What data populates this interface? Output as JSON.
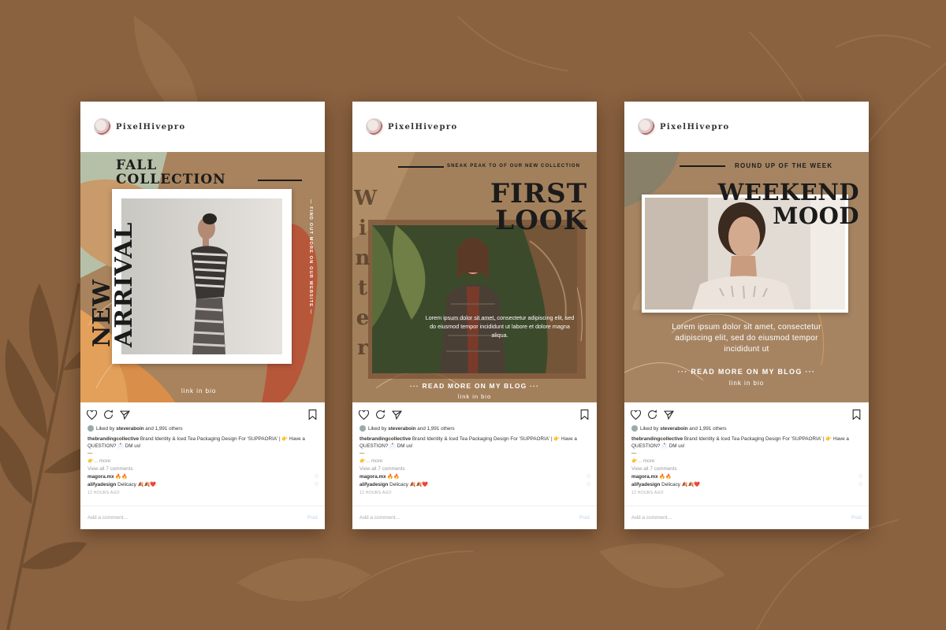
{
  "colors": {
    "background": "#8a6240",
    "post_brown": "#a68360",
    "accent_orange": "#e39a4c",
    "rust": "#b7573a",
    "sage": "#b7c3ad"
  },
  "posts": [
    {
      "username": "PixelHivepro",
      "avatar_icon": "profile-avatar",
      "title_line1": "FALL",
      "title_line2": "COLLECTION",
      "vertical_line1": "NEW",
      "vertical_line2": "ARRIVAL",
      "side_text": "— FIND OUT MORE ON OUR WEBSITE —",
      "link_text": "link in bio",
      "liked_by": "Liked by ",
      "liked_user": "steveraboin",
      "liked_rest": " and 1,991 others",
      "caption_user": "thebrandingcollective",
      "caption": " Brand Identity & Iced Tea Packaging Design For 'SUPPAORIA' | 👉 Have a QUESTION? 📩 DM us!",
      "caption_dash": "—",
      "more": "👉... more",
      "view_comments": "View all 7 comments",
      "comment1_user": "magora.mx",
      "comment1_text": " 🔥🔥",
      "comment2_user": "alifyadesign",
      "comment2_text": " Delicacy 🍂🍂❤️",
      "time": "12 HOURS AGO",
      "add_comment": "Add a comment...",
      "post_label": "Post"
    },
    {
      "username": "PixelHivepro",
      "avatar_icon": "profile-avatar",
      "sneak_peak": "SNEAK PEAK TO OF OUR NEW COLLECTION",
      "title_line1": "FIRST",
      "title_line2": "LOOK",
      "vertical_letters": [
        "W",
        "i",
        "n",
        "t",
        "e",
        "r"
      ],
      "body": "Lorem ipsum dolor sit amet, consectetur adipiscing elit, sed do eiusmod tempor incididunt ut labore et dolore magna aliqua.",
      "read_more": "··· READ MORE ON MY BLOG ···",
      "link_text": "link in bio",
      "liked_by": "Liked by ",
      "liked_user": "steveraboin",
      "liked_rest": " and 1,991 others",
      "caption_user": "thebrandingcollective",
      "caption": " Brand Identity & Iced Tea Packaging Design For 'SUPPAORIA' | 👉 Have a QUESTION? 📩 DM us!",
      "caption_dash": "—",
      "more": "👉... more",
      "view_comments": "View all 7 comments",
      "comment1_user": "magora.mx",
      "comment1_text": " 🔥🔥",
      "comment2_user": "alifyadesign",
      "comment2_text": " Delicacy 🍂🍂❤️",
      "time": "12 HOURS AGO",
      "add_comment": "Add a comment...",
      "post_label": "Post"
    },
    {
      "username": "PixelHivepro",
      "avatar_icon": "profile-avatar",
      "round_up": "ROUND UP OF THE WEEK",
      "title_line1": "WEEKEND",
      "title_line2": "MOOD",
      "body": "Lorem ipsum dolor sit amet, consectetur adipiscing elit, sed do eiusmod tempor incididunt ut",
      "read_more": "··· READ MORE ON MY BLOG ···",
      "link_text": "link in bio",
      "liked_by": "Liked by ",
      "liked_user": "steveraboin",
      "liked_rest": " and 1,991 others",
      "caption_user": "thebrandingcollective",
      "caption": " Brand Identity & Iced Tea Packaging Design For 'SUPPAORIA' | 👉 Have a QUESTION? 📩 DM us!",
      "caption_dash": "—",
      "more": "👉... more",
      "view_comments": "View all 7 comments",
      "comment1_user": "magora.mx",
      "comment1_text": " 🔥🔥",
      "comment2_user": "alifyadesign",
      "comment2_text": " Delicacy 🍂🍂❤️",
      "time": "12 HOURS AGO",
      "add_comment": "Add a comment...",
      "post_label": "Post"
    }
  ]
}
